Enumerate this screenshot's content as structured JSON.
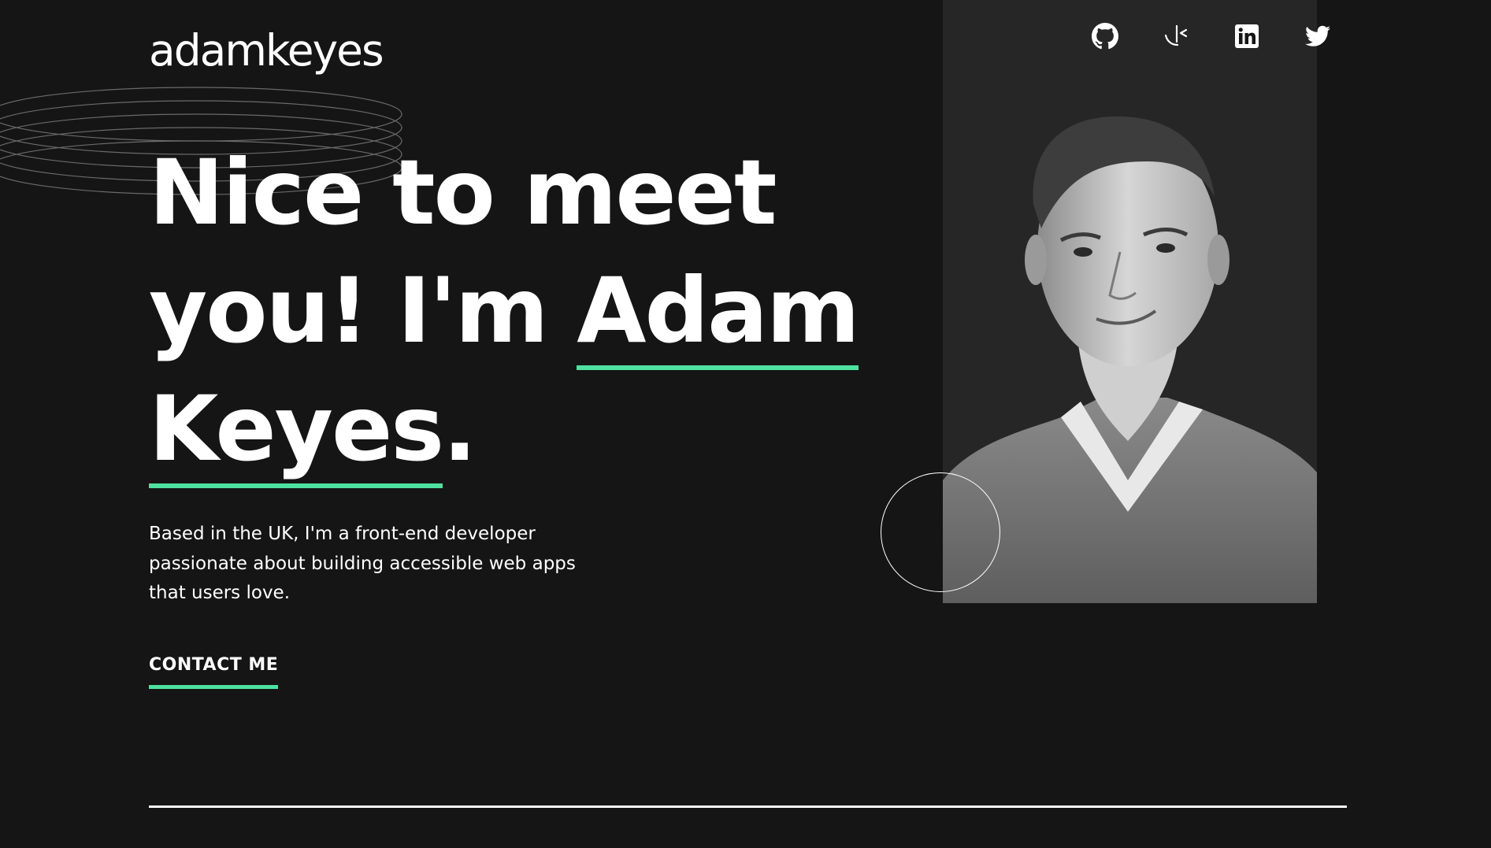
{
  "header": {
    "logo": "adamkeyes"
  },
  "social": {
    "icons": [
      "github-icon",
      "frontend-mentor-icon",
      "linkedin-icon",
      "twitter-icon"
    ]
  },
  "hero": {
    "line1": "Nice to meet",
    "line2_prefix": "you! I'm ",
    "name_first": "Adam",
    "name_last": "Keyes",
    "period": "."
  },
  "intro": {
    "text": "Based in the UK, I'm a front-end developer passionate about building accessible web apps that users love."
  },
  "cta": {
    "label": "CONTACT ME"
  },
  "colors": {
    "background": "#151515",
    "accent": "#4ee1a0",
    "photo_panel": "#262626",
    "text": "#ffffff"
  }
}
